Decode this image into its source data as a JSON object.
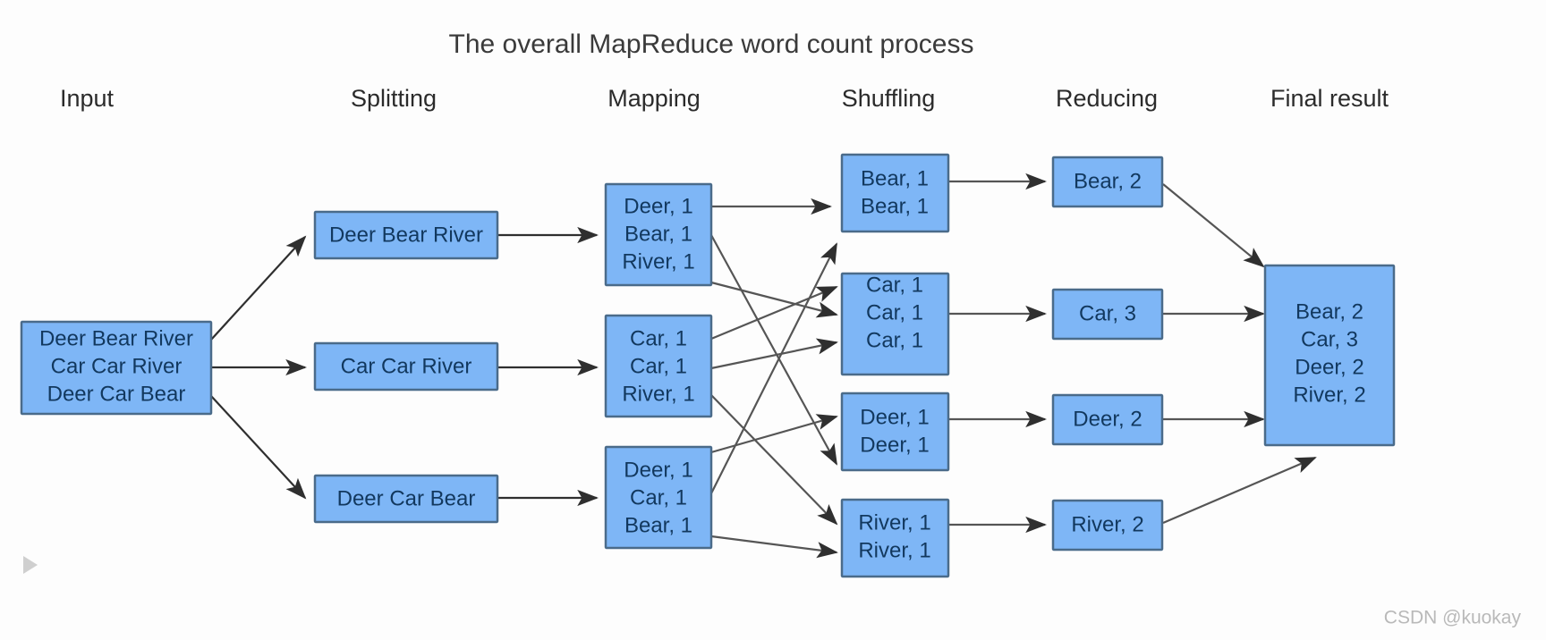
{
  "title": "The overall MapReduce word count process",
  "watermark": "CSDN @kuokay",
  "colors": {
    "box_fill": "#7eb6f6",
    "box_stroke": "#4a6b8a",
    "text": "#12385e",
    "edge": "#555555",
    "title": "#3a3a3a",
    "background": "#fdfdfd"
  },
  "stages": [
    {
      "id": "input",
      "label": "Input"
    },
    {
      "id": "splitting",
      "label": "Splitting"
    },
    {
      "id": "mapping",
      "label": "Mapping"
    },
    {
      "id": "shuffling",
      "label": "Shuffling"
    },
    {
      "id": "reducing",
      "label": "Reducing"
    },
    {
      "id": "final",
      "label": "Final result"
    }
  ],
  "input": {
    "lines": [
      "Deer Bear River",
      "Car Car River",
      "Deer Car Bear"
    ]
  },
  "splitting": {
    "boxes": [
      {
        "lines": [
          "Deer Bear River"
        ]
      },
      {
        "lines": [
          "Car Car River"
        ]
      },
      {
        "lines": [
          "Deer Car Bear"
        ]
      }
    ]
  },
  "mapping": {
    "boxes": [
      {
        "lines": [
          "Deer, 1",
          "Bear, 1",
          "River, 1"
        ]
      },
      {
        "lines": [
          "Car, 1",
          "Car, 1",
          "River, 1"
        ]
      },
      {
        "lines": [
          "Deer, 1",
          "Car, 1",
          "Bear, 1"
        ]
      }
    ]
  },
  "shuffling": {
    "boxes": [
      {
        "lines": [
          "Bear, 1",
          "Bear, 1"
        ]
      },
      {
        "lines": [
          "Car, 1",
          "Car, 1",
          "Car, 1"
        ]
      },
      {
        "lines": [
          "Deer, 1",
          "Deer, 1"
        ]
      },
      {
        "lines": [
          "River, 1",
          "River, 1"
        ]
      }
    ]
  },
  "reducing": {
    "boxes": [
      {
        "lines": [
          "Bear, 2"
        ]
      },
      {
        "lines": [
          "Car, 3"
        ]
      },
      {
        "lines": [
          "Deer, 2"
        ]
      },
      {
        "lines": [
          "River, 2"
        ]
      }
    ]
  },
  "final": {
    "lines": [
      "Bear, 2",
      "Car, 3",
      "Deer, 2",
      "River, 2"
    ]
  }
}
